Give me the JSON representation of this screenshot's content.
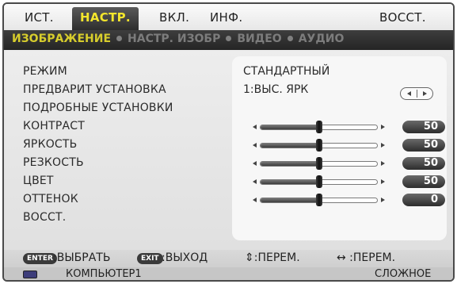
{
  "tabs": {
    "ist": "ИСТ.",
    "nastr": "НАСТР.",
    "vkl": "ВКЛ.",
    "inf": "ИНФ.",
    "vosst": "ВОССТ."
  },
  "subtabs": {
    "image": "ИЗОБРАЖЕНИЕ",
    "image_settings": "НАСТР. ИЗОБР",
    "video": "ВИДЕО",
    "audio": "АУДИО"
  },
  "labels": {
    "mode": "РЕЖИМ",
    "preset": "ПРЕДВАРИТ УСТАНОВКА",
    "detail": "ПОДРОБНЫЕ УСТАНОВКИ",
    "contrast": "КОНТРАСТ",
    "brightness": "ЯРКОСТЬ",
    "sharpness": "РЕЗКОСТЬ",
    "color": "ЦВЕТ",
    "hue": "ОТТЕНОК",
    "reset": "ВОССТ."
  },
  "values": {
    "mode": "СТАНДАРТНЫЙ",
    "preset": "1:ВЫС. ЯРК",
    "contrast": "50",
    "brightness": "50",
    "sharpness": "50",
    "color": "50",
    "hue": "0"
  },
  "slider_levels": {
    "contrast": 0.5,
    "brightness": 0.5,
    "sharpness": 0.5,
    "color": 0.5,
    "hue": 0.5
  },
  "help": {
    "enter_key": "ENTER",
    "select": ":ВЫБРАТЬ",
    "exit_key": "EXIT",
    "exit": ":ВЫХОД",
    "move_updown": "⇕:ПЕРЕМ.",
    "move_leftright": "↔ :ПЕРЕМ."
  },
  "status": {
    "source": "КОМПЬЮТЕР1",
    "level": "СЛОЖНОЕ"
  },
  "colors": {
    "active_tab_text": "#f4e62c",
    "active_subtab_text": "#d7cd2c"
  },
  "icons": {
    "source": "computer-input-icon",
    "adjust": "left-right-arrows-icon"
  }
}
